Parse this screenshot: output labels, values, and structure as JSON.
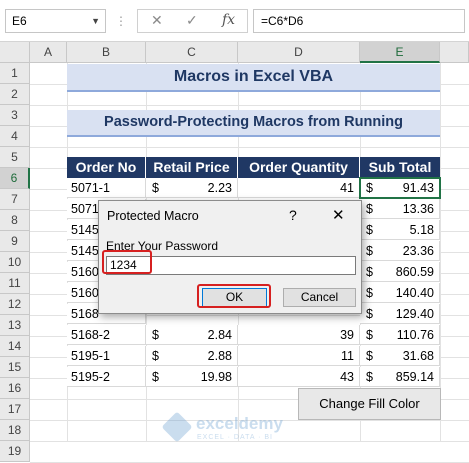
{
  "formula_bar": {
    "name_box": "E6",
    "cancel_glyph": "✕",
    "enter_glyph": "✓",
    "fx_glyph": "fx",
    "formula": "=C6*D6"
  },
  "columns": [
    "A",
    "B",
    "C",
    "D",
    "E"
  ],
  "rows": [
    "1",
    "2",
    "3",
    "4",
    "5",
    "6",
    "7",
    "8",
    "9",
    "10",
    "11",
    "12",
    "13",
    "14",
    "15",
    "16",
    "17",
    "18",
    "19"
  ],
  "sheet": {
    "title": "Macros in Excel VBA",
    "subtitle": "Password-Protecting Macros from Running",
    "headers": [
      "Order No",
      "Retail Price",
      "Order Quantity",
      "Sub Total"
    ],
    "currency_symbol": "$",
    "rows": [
      {
        "order": "5071-1",
        "price": "2.23",
        "qty": "41",
        "sub": "91.43"
      },
      {
        "order": "5071",
        "price": "",
        "qty": "",
        "sub": "13.36"
      },
      {
        "order": "5145",
        "price": "",
        "qty": "",
        "sub": "5.18"
      },
      {
        "order": "5145",
        "price": "",
        "qty": "",
        "sub": "23.36"
      },
      {
        "order": "5160",
        "price": "",
        "qty": "",
        "sub": "860.59"
      },
      {
        "order": "5160",
        "price": "",
        "qty": "",
        "sub": "140.40"
      },
      {
        "order": "5168",
        "price": "",
        "qty": "",
        "sub": "129.40"
      },
      {
        "order": "5168-2",
        "price": "2.84",
        "qty": "39",
        "sub": "110.76"
      },
      {
        "order": "5195-1",
        "price": "2.88",
        "qty": "11",
        "sub": "31.68"
      },
      {
        "order": "5195-2",
        "price": "19.98",
        "qty": "43",
        "sub": "859.14"
      }
    ],
    "button_label": "Change Fill Color"
  },
  "dialog": {
    "title": "Protected Macro",
    "help_glyph": "?",
    "close_glyph": "✕",
    "prompt": "Enter Your Password",
    "input_value": "1234",
    "ok_label": "OK",
    "cancel_label": "Cancel"
  },
  "watermark": {
    "brand": "exceldemy",
    "tagline": "EXCEL · DATA · BI"
  },
  "colors": {
    "header_fill": "#203864",
    "title_fill": "#d9e1f2",
    "selection": "#217346",
    "highlight": "#d62020"
  }
}
